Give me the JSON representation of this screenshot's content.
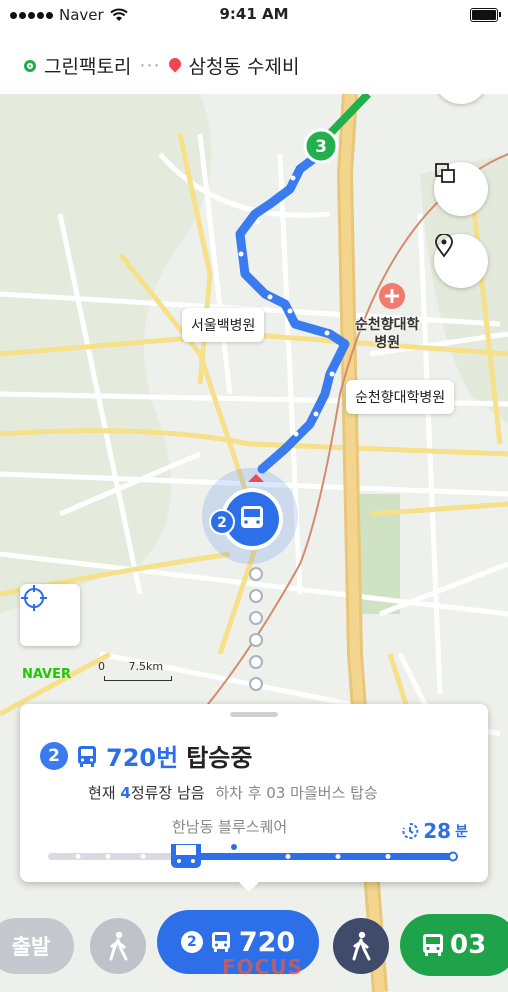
{
  "status": {
    "carrier": "Naver",
    "time": "9:41 AM"
  },
  "route": {
    "origin": "그린팩토리",
    "separator": "···",
    "destination": "삼청동 수제비"
  },
  "map": {
    "labels": {
      "hospital1": "서울백병원",
      "hospital2": "순천향대학병원",
      "poi": "순천향대학\n병원"
    },
    "route_marker_3": "3",
    "bus_marker_num": "2",
    "logo": "NAVER",
    "scale": {
      "zero": "0",
      "distance": "7.5km"
    }
  },
  "card": {
    "badge": "2",
    "bus_number": "720번",
    "status": "탑승중",
    "remaining_prefix": "현재 ",
    "remaining_count": "4",
    "remaining_suffix": "정류장 남음",
    "next_action": "하차 후 03 마을버스 탑승",
    "stop_name": "한남동 블루스퀘어",
    "eta_value": "28",
    "eta_unit": "분"
  },
  "bottom": {
    "start_label": "출발",
    "active_badge": "2",
    "active_route": "720",
    "bus_route": "03",
    "watermark": "FOCUS"
  },
  "colors": {
    "route_blue": "#3a7cf0",
    "green": "#1fa34a",
    "naver_green": "#1ec800"
  }
}
